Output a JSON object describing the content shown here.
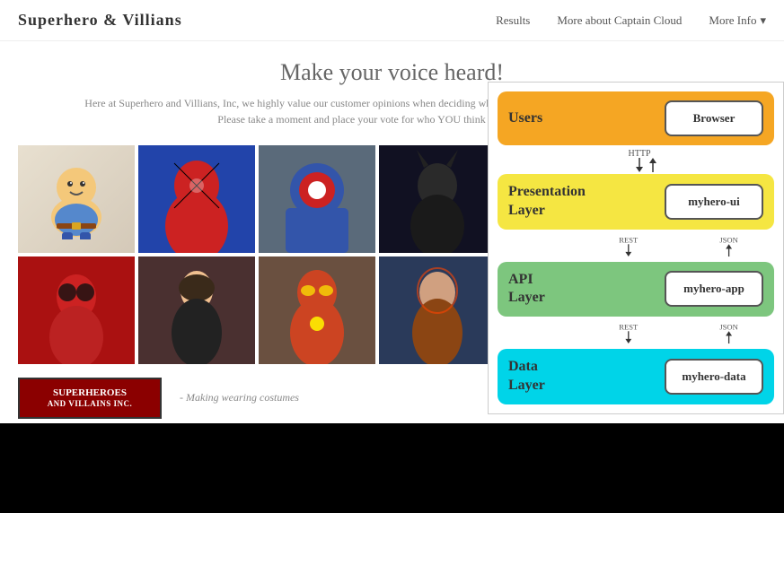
{
  "nav": {
    "brand": "Superhero & Villians",
    "links": [
      {
        "label": "Results",
        "dropdown": false
      },
      {
        "label": "More about Captain Cloud",
        "dropdown": false
      },
      {
        "label": "More Info",
        "dropdown": true
      }
    ]
  },
  "hero": {
    "title": "Make your voice heard!",
    "subtitle": "Here at Superhero and Villians, Inc, we highly value our customer opinions when deciding what hero's should star in our next movie or comic. Please take a moment and place your vote for who YOU think deserves a place..."
  },
  "grid": {
    "characters": [
      {
        "name": "fat-cartoon",
        "bg": "char-0"
      },
      {
        "name": "spiderman",
        "bg": "char-1"
      },
      {
        "name": "captain-america",
        "bg": "char-2"
      },
      {
        "name": "batman",
        "bg": "char-3"
      },
      {
        "name": "deadpool",
        "bg": "char-4"
      },
      {
        "name": "black-widow",
        "bg": "char-5"
      },
      {
        "name": "iron-man",
        "bg": "char-6"
      },
      {
        "name": "starlord",
        "bg": "char-7"
      }
    ]
  },
  "bottom": {
    "logo_line1": "SUPERHEROES",
    "logo_line2": "AND VILLAINS INC.",
    "tagline": "- Making wearing costumes"
  },
  "architecture": {
    "layers": [
      {
        "id": "users",
        "label": "Users",
        "box_label": "Browser",
        "color_class": "layer-users"
      },
      {
        "id": "presentation",
        "label": "Presentation Layer",
        "box_label": "myhero-ui",
        "color_class": "layer-presentation",
        "connector": {
          "left": "REST",
          "right": "JSON"
        }
      },
      {
        "id": "api",
        "label": "API Layer",
        "box_label": "myhero-app",
        "color_class": "layer-api",
        "connector": {
          "left": "REST",
          "right": "JSON"
        }
      },
      {
        "id": "data",
        "label": "Data Layer",
        "box_label": "myhero-data",
        "color_class": "layer-data"
      }
    ],
    "connectors": [
      {
        "label": "HTTP"
      },
      {
        "left": "REST",
        "right": "JSON"
      },
      {
        "left": "REST",
        "right": "JSON"
      }
    ]
  }
}
